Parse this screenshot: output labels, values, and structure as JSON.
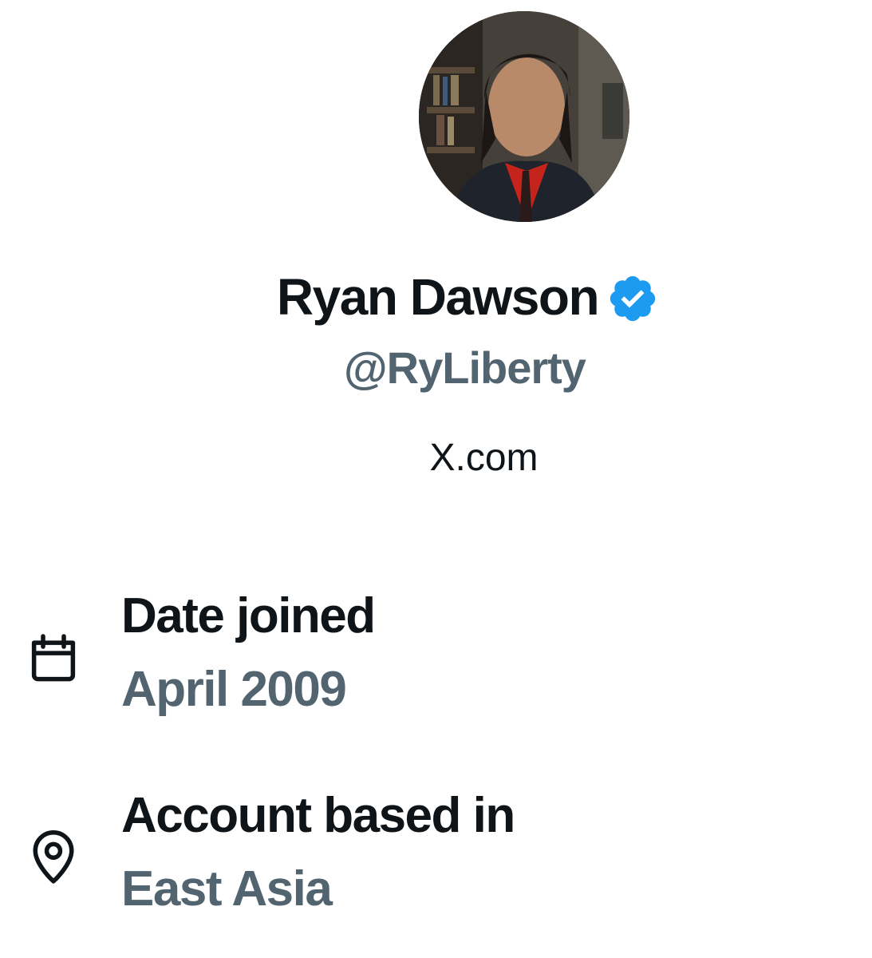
{
  "profile": {
    "display_name": "Ryan Dawson",
    "verified": true,
    "handle": "@RyLiberty",
    "site": "X.com",
    "avatar_icon": "profile-photo"
  },
  "about": {
    "date_joined": {
      "icon": "calendar-icon",
      "label": "Date joined",
      "value": "April 2009"
    },
    "account_based_in": {
      "icon": "location-pin-icon",
      "label": "Account based in",
      "value": "East Asia"
    }
  },
  "colors": {
    "primary_text": "#0f1419",
    "secondary_text": "#536471",
    "verified_blue": "#1d9bf0",
    "background": "#ffffff"
  }
}
